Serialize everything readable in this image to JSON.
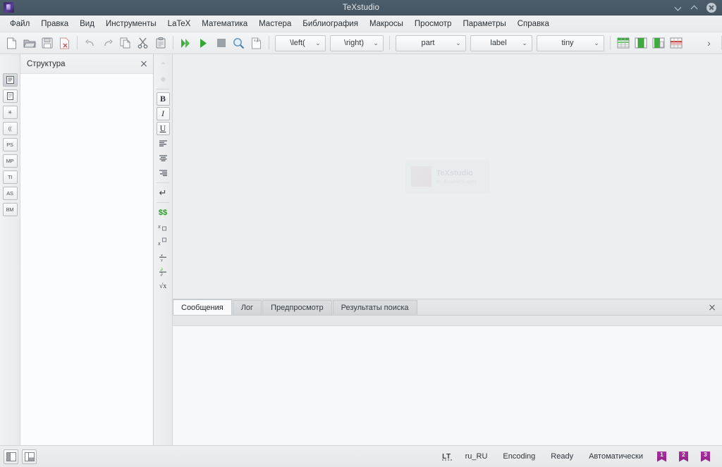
{
  "window": {
    "title": "TeXstudio",
    "app_icon": "texstudio-logo-icon",
    "minimize_label": "Minimize",
    "maximize_label": "Maximize",
    "close_label": "Close"
  },
  "menubar": {
    "items": [
      {
        "label": "Файл"
      },
      {
        "label": "Правка"
      },
      {
        "label": "Вид"
      },
      {
        "label": "Инструменты"
      },
      {
        "label": "LaTeX"
      },
      {
        "label": "Математика"
      },
      {
        "label": "Мастера"
      },
      {
        "label": "Библиография"
      },
      {
        "label": "Макросы"
      },
      {
        "label": "Просмотр"
      },
      {
        "label": "Параметры"
      },
      {
        "label": "Справка"
      }
    ]
  },
  "toolbar": {
    "buttons": [
      {
        "name": "new-file-icon"
      },
      {
        "name": "open-file-icon"
      },
      {
        "name": "save-file-icon"
      },
      {
        "name": "close-file-icon"
      },
      {
        "name": "undo-icon"
      },
      {
        "name": "redo-icon"
      },
      {
        "name": "copy-icon"
      },
      {
        "name": "cut-icon"
      },
      {
        "name": "paste-icon"
      },
      {
        "name": "build-and-view-icon"
      },
      {
        "name": "compile-icon"
      },
      {
        "name": "stop-icon"
      },
      {
        "name": "view-pdf-icon"
      },
      {
        "name": "view-log-icon"
      }
    ],
    "combos": [
      {
        "name": "left-delimiter-select",
        "value": "\\left("
      },
      {
        "name": "right-delimiter-select",
        "value": "\\right)"
      },
      {
        "name": "section-level-select",
        "value": "part"
      },
      {
        "name": "reference-type-select",
        "value": "label"
      },
      {
        "name": "font-size-select",
        "value": "tiny"
      }
    ],
    "table_buttons": [
      {
        "name": "insert-table-icon"
      },
      {
        "name": "insert-column-icon"
      },
      {
        "name": "add-column-icon"
      },
      {
        "name": "delete-row-icon"
      }
    ],
    "overflow_label": "›",
    "nav_back_label": "‹",
    "nav_forward_label": "›"
  },
  "rail": {
    "items": [
      {
        "label": "",
        "name": "structure-view-icon",
        "active": true
      },
      {
        "label": "",
        "name": "files-view-icon",
        "active": false
      },
      {
        "label": "✳",
        "name": "symbols-view-icon",
        "active": false
      },
      {
        "label": "((",
        "name": "brackets-view-icon",
        "active": false
      },
      {
        "label": "PS",
        "name": "postscript-symbols-icon",
        "active": false
      },
      {
        "label": "MP",
        "name": "metapost-symbols-icon",
        "active": false
      },
      {
        "label": "TI",
        "name": "tikz-symbols-icon",
        "active": false
      },
      {
        "label": "AS",
        "name": "asymptote-symbols-icon",
        "active": false
      },
      {
        "label": "BM",
        "name": "bookmarks-view-icon",
        "active": false
      }
    ]
  },
  "structure_panel": {
    "title": "Структура",
    "close_label": "✕"
  },
  "format_rail": {
    "items": [
      {
        "name": "indent-decrease-icon",
        "glyph": ""
      },
      {
        "name": "indent-increase-icon",
        "glyph": ""
      },
      {
        "name": "bold-icon",
        "glyph": "B"
      },
      {
        "name": "italic-icon",
        "glyph": "I"
      },
      {
        "name": "underline-icon",
        "glyph": "U"
      },
      {
        "name": "align-left-icon",
        "glyph": ""
      },
      {
        "name": "align-center-icon",
        "glyph": ""
      },
      {
        "name": "align-right-icon",
        "glyph": ""
      },
      {
        "name": "newline-icon",
        "glyph": "↵"
      },
      {
        "name": "math-mode-icon",
        "glyph": "$$"
      },
      {
        "name": "subscript-icon",
        "glyph": ""
      },
      {
        "name": "superscript-icon",
        "glyph": ""
      },
      {
        "name": "fraction-icon",
        "glyph": ""
      },
      {
        "name": "derivative-icon",
        "glyph": ""
      },
      {
        "name": "square-root-icon",
        "glyph": "√x"
      }
    ]
  },
  "editor": {
    "watermark_title": "TeXstudio",
    "watermark_subtitle": "no document open"
  },
  "bottom_panel": {
    "tabs": [
      {
        "label": "Сообщения",
        "active": true
      },
      {
        "label": "Лог",
        "active": false
      },
      {
        "label": "Предпросмотр",
        "active": false
      },
      {
        "label": "Результаты поиска",
        "active": false
      }
    ],
    "close_label": "✕"
  },
  "statusbar": {
    "left_toggles": [
      {
        "name": "toggle-structure-panel-button"
      },
      {
        "name": "toggle-output-panel-button"
      }
    ],
    "language_tool": "LT",
    "locale": "ru_RU",
    "encoding": "Encoding",
    "state": "Ready",
    "line_ending": "Автоматически",
    "bookmarks": [
      {
        "label": "1"
      },
      {
        "label": "2"
      },
      {
        "label": "3"
      }
    ]
  },
  "colors": {
    "titlebar": "#4c5c68",
    "chrome": "#eff0f1",
    "editor_bg": "#eceef0",
    "accent_green": "#3faa3f",
    "accent_red": "#d9534f",
    "bookmark_purple": "#a9309f"
  }
}
